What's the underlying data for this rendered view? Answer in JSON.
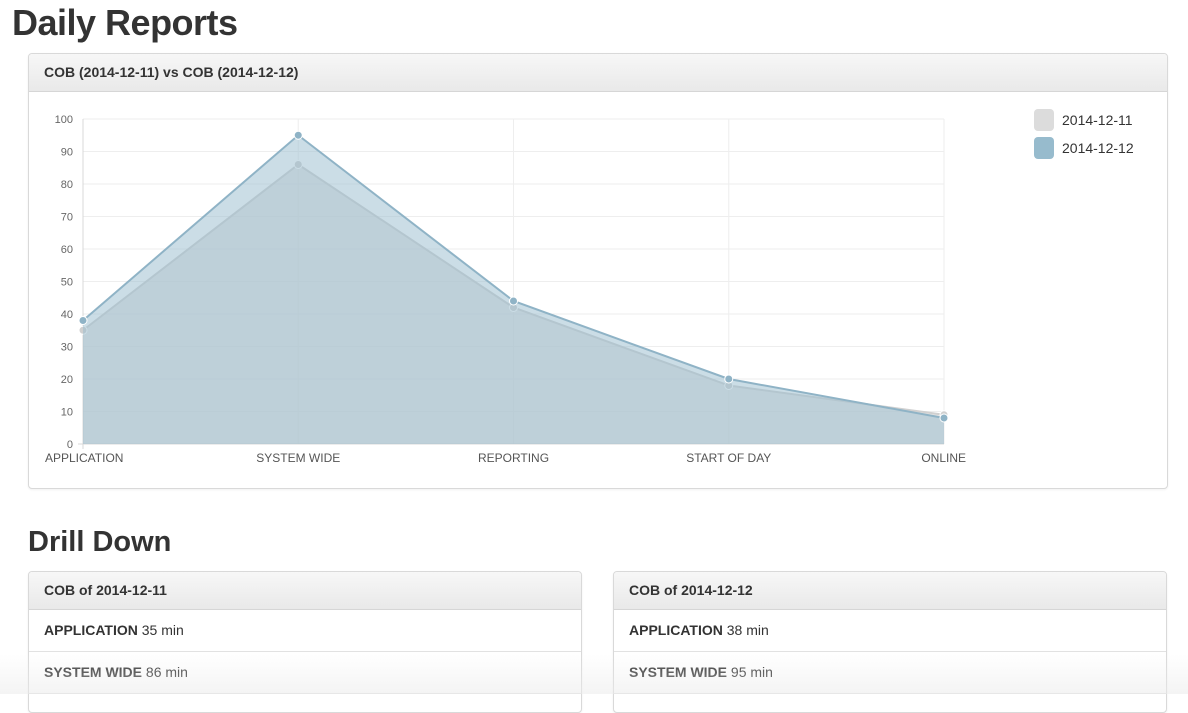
{
  "page": {
    "title": "Daily Reports"
  },
  "chart_panel": {
    "heading": "COB (2014-12-11) vs COB (2014-12-12)"
  },
  "chart_data": {
    "type": "area",
    "categories": [
      "APPLICATION",
      "SYSTEM WIDE",
      "REPORTING",
      "START OF DAY",
      "ONLINE"
    ],
    "series": [
      {
        "name": "2014-12-11",
        "values": [
          35,
          86,
          42,
          18,
          9
        ],
        "color": "#dcdcdc",
        "fill": "#d4d4d4",
        "stroke": "#d0d0d0"
      },
      {
        "name": "2014-12-12",
        "values": [
          38,
          95,
          44,
          20,
          8
        ],
        "color": "#97bbcd",
        "fill": "#97bbcd",
        "stroke": "#8fb3c6"
      }
    ],
    "ylim": [
      0,
      100
    ],
    "yticks": [
      0,
      10,
      20,
      30,
      40,
      50,
      60,
      70,
      80,
      90,
      100
    ],
    "grid": true,
    "legend_position": "top-right"
  },
  "drilldown": {
    "title": "Drill Down",
    "panels": [
      {
        "heading": "COB of 2014-12-11",
        "rows": [
          {
            "label": "APPLICATION",
            "value": "35 min"
          },
          {
            "label": "SYSTEM WIDE",
            "value": "86 min"
          }
        ]
      },
      {
        "heading": "COB of 2014-12-12",
        "rows": [
          {
            "label": "APPLICATION",
            "value": "38 min"
          },
          {
            "label": "SYSTEM WIDE",
            "value": "95 min"
          }
        ]
      }
    ]
  }
}
